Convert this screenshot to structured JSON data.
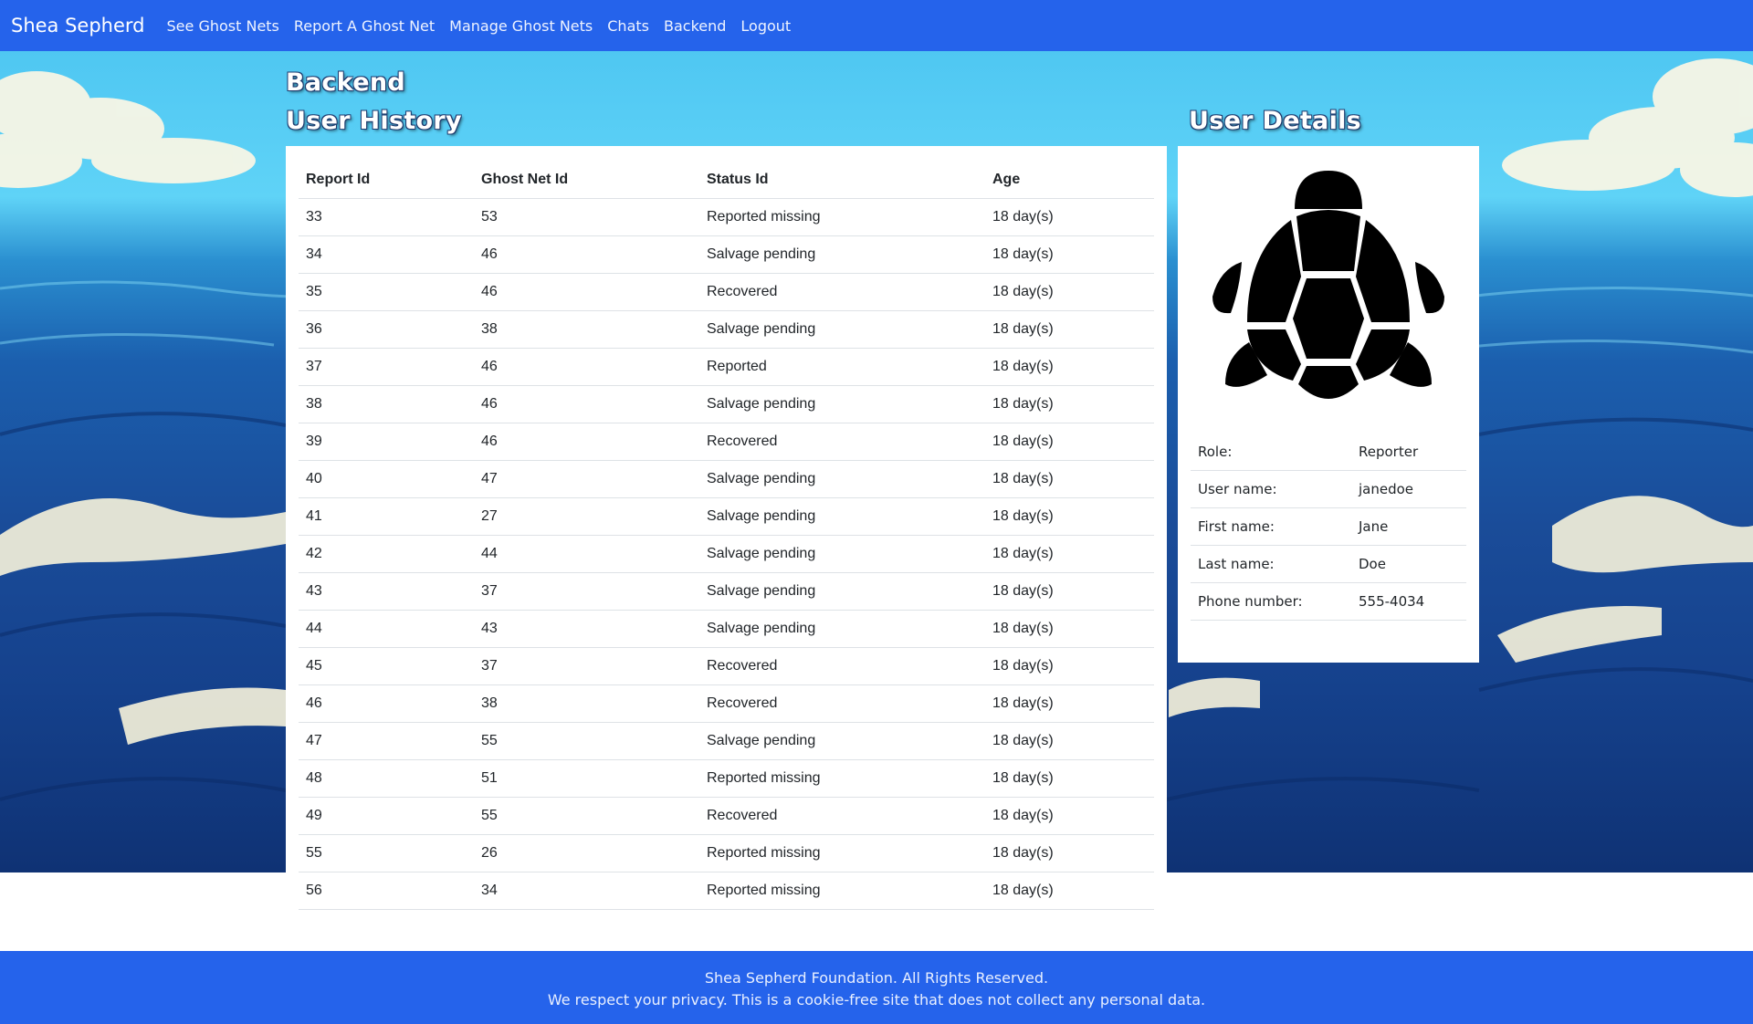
{
  "navbar": {
    "brand": "Shea Sepherd",
    "links": [
      "See Ghost Nets",
      "Report A Ghost Net",
      "Manage Ghost Nets",
      "Chats",
      "Backend",
      "Logout"
    ]
  },
  "page": {
    "title": "Backend",
    "history_title": "User History",
    "details_title": "User Details"
  },
  "history": {
    "columns": [
      "Report Id",
      "Ghost Net Id",
      "Status Id",
      "Age"
    ],
    "rows": [
      [
        "33",
        "53",
        "Reported missing",
        "18 day(s)"
      ],
      [
        "34",
        "46",
        "Salvage pending",
        "18 day(s)"
      ],
      [
        "35",
        "46",
        "Recovered",
        "18 day(s)"
      ],
      [
        "36",
        "38",
        "Salvage pending",
        "18 day(s)"
      ],
      [
        "37",
        "46",
        "Reported",
        "18 day(s)"
      ],
      [
        "38",
        "46",
        "Salvage pending",
        "18 day(s)"
      ],
      [
        "39",
        "46",
        "Recovered",
        "18 day(s)"
      ],
      [
        "40",
        "47",
        "Salvage pending",
        "18 day(s)"
      ],
      [
        "41",
        "27",
        "Salvage pending",
        "18 day(s)"
      ],
      [
        "42",
        "44",
        "Salvage pending",
        "18 day(s)"
      ],
      [
        "43",
        "37",
        "Salvage pending",
        "18 day(s)"
      ],
      [
        "44",
        "43",
        "Salvage pending",
        "18 day(s)"
      ],
      [
        "45",
        "37",
        "Recovered",
        "18 day(s)"
      ],
      [
        "46",
        "38",
        "Recovered",
        "18 day(s)"
      ],
      [
        "47",
        "55",
        "Salvage pending",
        "18 day(s)"
      ],
      [
        "48",
        "51",
        "Reported missing",
        "18 day(s)"
      ],
      [
        "49",
        "55",
        "Recovered",
        "18 day(s)"
      ],
      [
        "55",
        "26",
        "Reported missing",
        "18 day(s)"
      ],
      [
        "56",
        "34",
        "Reported missing",
        "18 day(s)"
      ]
    ]
  },
  "details": {
    "avatar_icon": "turtle-icon",
    "fields": [
      {
        "label": "Role:",
        "value": "Reporter"
      },
      {
        "label": "User name:",
        "value": "janedoe"
      },
      {
        "label": "First name:",
        "value": "Jane"
      },
      {
        "label": "Last name:",
        "value": "Doe"
      },
      {
        "label": "Phone number:",
        "value": "555-4034"
      }
    ]
  },
  "footer": {
    "line1": "Shea Sepherd Foundation. All Rights Reserved.",
    "line2": "We respect your privacy. This is a cookie-free site that does not collect any personal data."
  },
  "colors": {
    "navbar": "#2563eb",
    "footer": "#2563eb",
    "panel": "#ffffff"
  }
}
